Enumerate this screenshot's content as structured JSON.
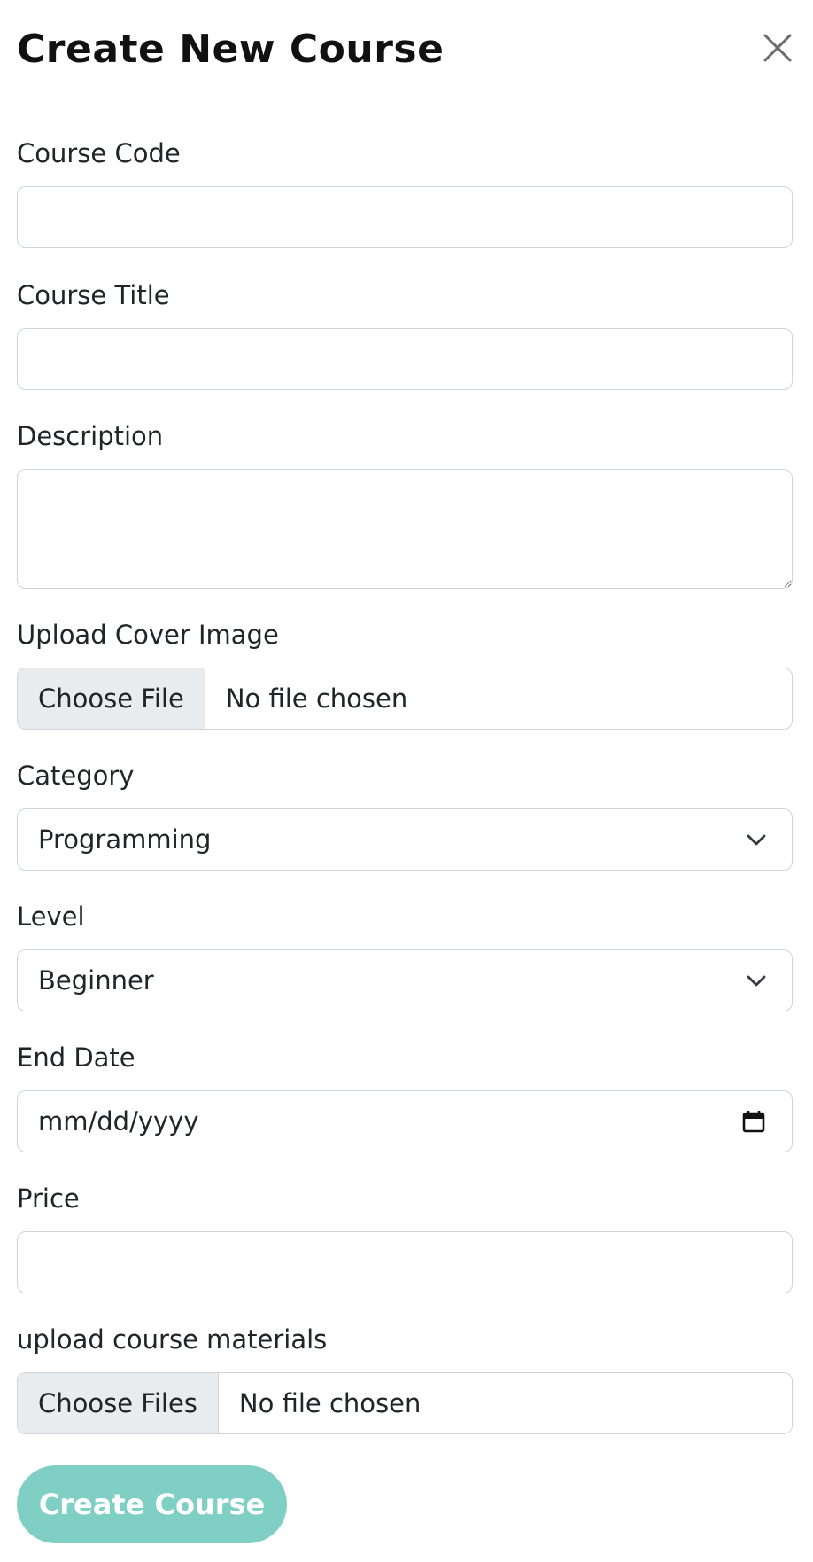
{
  "modal": {
    "title": "Create New Course",
    "close_icon": "close-icon"
  },
  "form": {
    "course_code": {
      "label": "Course Code",
      "value": "",
      "placeholder": ""
    },
    "course_title": {
      "label": "Course Title",
      "value": "",
      "placeholder": ""
    },
    "description": {
      "label": "Description",
      "value": "",
      "placeholder": ""
    },
    "cover_image": {
      "label": "Upload Cover Image",
      "button_label": "Choose File",
      "status": "No file chosen"
    },
    "category": {
      "label": "Category",
      "selected": "Programming",
      "icon": "chevron-down-icon"
    },
    "level": {
      "label": "Level",
      "selected": "Beginner",
      "icon": "chevron-down-icon"
    },
    "end_date": {
      "label": "End Date",
      "placeholder": "mm/dd/yyyy",
      "icon": "calendar-icon"
    },
    "price": {
      "label": "Price",
      "value": "",
      "placeholder": ""
    },
    "materials": {
      "label": "upload course materials",
      "button_label": "Choose Files",
      "status": "No file chosen"
    },
    "submit_label": "Create Course"
  },
  "colors": {
    "accent": "#80cfc5",
    "border": "#ced4da",
    "file_button_bg": "#e9ecef",
    "text": "#212529"
  }
}
